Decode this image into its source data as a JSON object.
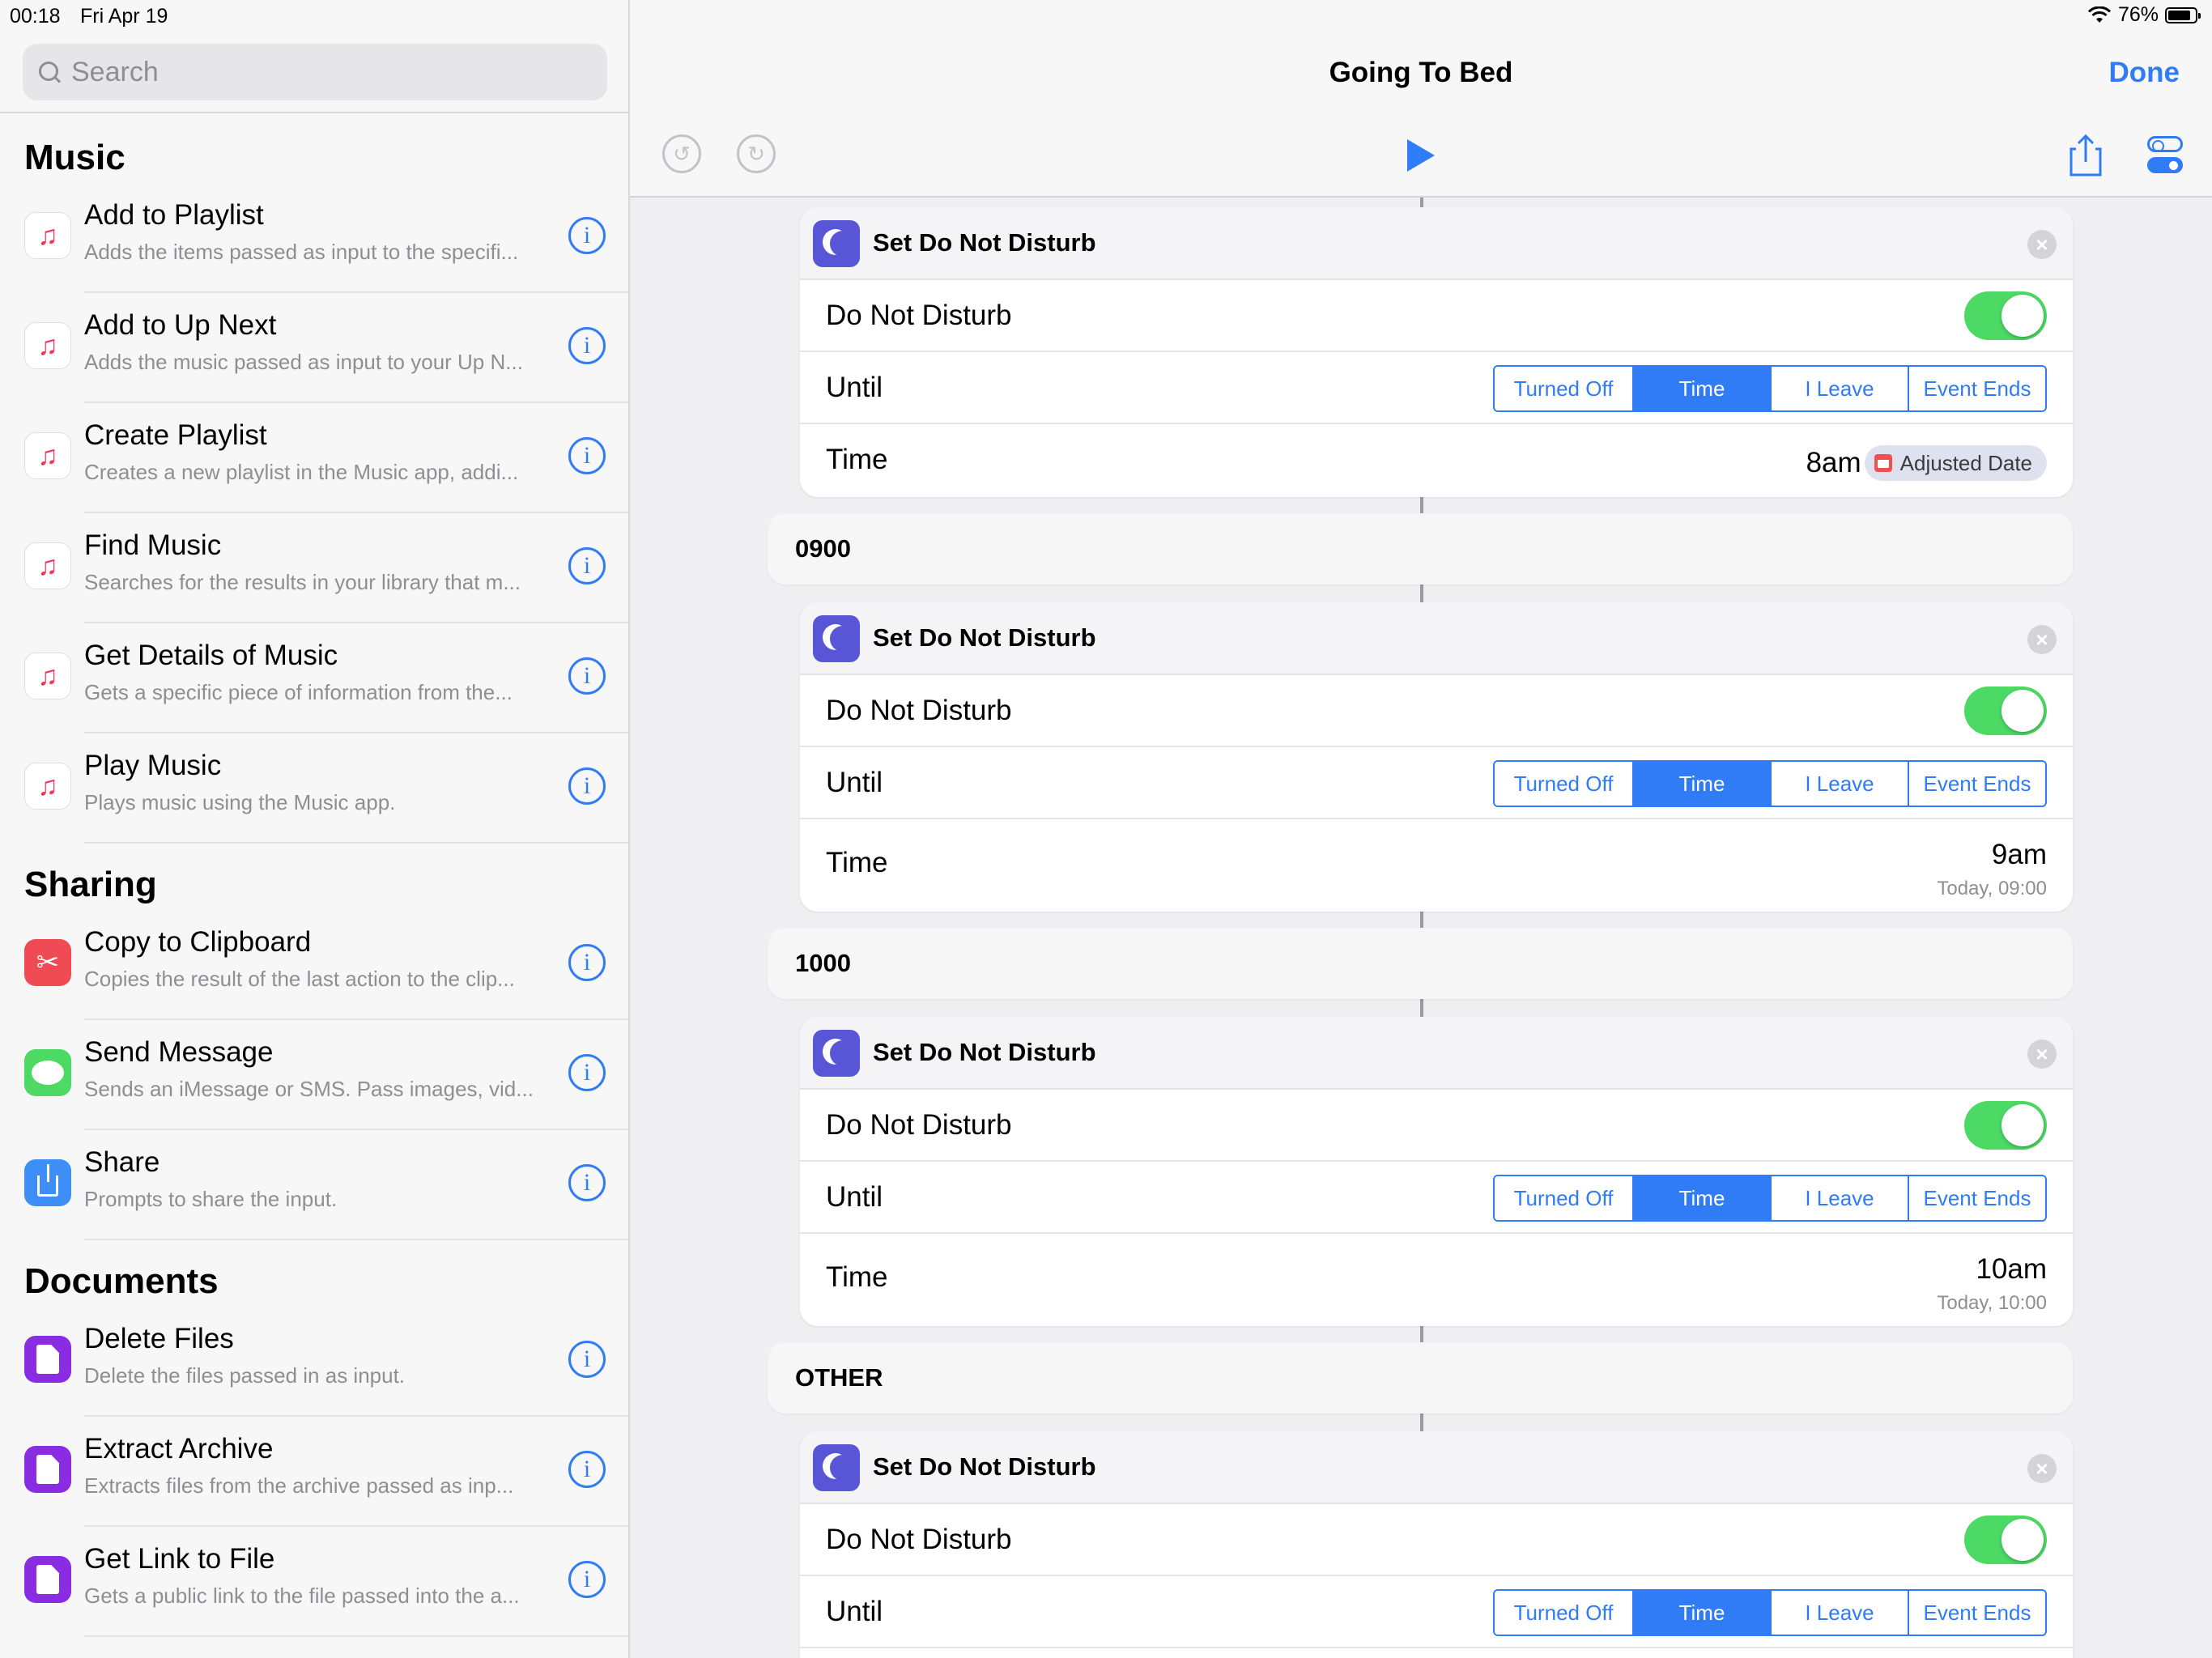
{
  "status": {
    "time": "00:18",
    "date": "Fri Apr 19",
    "battery": "76%",
    "battery_fill": 0.76
  },
  "sidebar": {
    "search_placeholder": "Search",
    "sections": [
      {
        "title": "Music",
        "items": [
          {
            "title": "Add to Playlist",
            "desc": "Adds the items passed as input to the specifi...",
            "icon": "music-note-icon"
          },
          {
            "title": "Add to Up Next",
            "desc": "Adds the music passed as input to your Up N...",
            "icon": "music-note-icon"
          },
          {
            "title": "Create Playlist",
            "desc": "Creates a new playlist in the Music app, addi...",
            "icon": "music-note-icon"
          },
          {
            "title": "Find Music",
            "desc": "Searches for the results in your library that m...",
            "icon": "music-note-icon"
          },
          {
            "title": "Get Details of Music",
            "desc": "Gets a specific piece of information from the...",
            "icon": "music-note-icon"
          },
          {
            "title": "Play Music",
            "desc": "Plays music using the Music app.",
            "icon": "music-note-icon"
          }
        ]
      },
      {
        "title": "Sharing",
        "items": [
          {
            "title": "Copy to Clipboard",
            "desc": "Copies the result of the last action to the clip...",
            "icon": "scissors-icon"
          },
          {
            "title": "Send Message",
            "desc": "Sends an iMessage or SMS. Pass images, vid...",
            "icon": "message-bubble-icon"
          },
          {
            "title": "Share",
            "desc": "Prompts to share the input.",
            "icon": "share-icon"
          }
        ]
      },
      {
        "title": "Documents",
        "items": [
          {
            "title": "Delete Files",
            "desc": "Delete the files passed in as input.",
            "icon": "file-icon"
          },
          {
            "title": "Extract Archive",
            "desc": "Extracts files from the archive passed as inp...",
            "icon": "file-icon"
          },
          {
            "title": "Get Link to File",
            "desc": "Gets a public link to the file passed into the a...",
            "icon": "file-icon"
          }
        ]
      }
    ]
  },
  "main": {
    "title": "Going To Bed",
    "done_label": "Done",
    "segments": [
      "Turned Off",
      "Time",
      "I Leave",
      "Event Ends"
    ],
    "selected_segment": "Time",
    "cards": [
      {
        "title": "Set Do Not Disturb",
        "dnd_label": "Do Not Disturb",
        "dnd_on": true,
        "until_label": "Until",
        "time_label": "Time",
        "time_value": "8am",
        "time_token": "Adjusted Date",
        "time_sub": ""
      },
      {
        "title": "Set Do Not Disturb",
        "dnd_label": "Do Not Disturb",
        "dnd_on": true,
        "until_label": "Until",
        "time_label": "Time",
        "time_value": "9am",
        "time_token": "",
        "time_sub": "Today, 09:00"
      },
      {
        "title": "Set Do Not Disturb",
        "dnd_label": "Do Not Disturb",
        "dnd_on": true,
        "until_label": "Until",
        "time_label": "Time",
        "time_value": "10am",
        "time_token": "",
        "time_sub": "Today, 10:00"
      },
      {
        "title": "Set Do Not Disturb",
        "dnd_label": "Do Not Disturb",
        "dnd_on": true,
        "until_label": "Until",
        "time_label": "",
        "time_value": "",
        "time_token": "",
        "time_sub": ""
      }
    ],
    "section_labels": [
      "0900",
      "1000",
      "OTHER"
    ]
  },
  "colors": {
    "accent": "#2f7cf6",
    "toggle_on": "#4cd964",
    "dnd_icon": "#5856d6"
  }
}
